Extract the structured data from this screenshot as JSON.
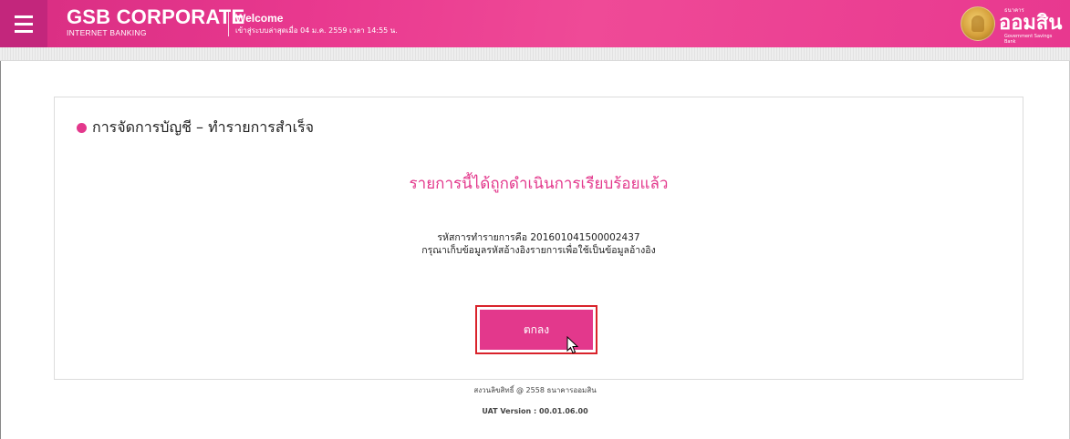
{
  "header": {
    "brand_title": "GSB CORPORATE",
    "brand_subtitle": "INTERNET BANKING",
    "welcome_title": "Welcome",
    "last_login": "เข้าสู่ระบบล่าสุดเมื่อ 04 ม.ค. 2559 เวลา 14:55 น.",
    "logo_small": "ธนาคาร",
    "logo_name": "ออมสิน",
    "logo_en": "Government Savings Bank",
    "menu_icon": "hamburger-menu-icon",
    "color_primary": "#e3388c"
  },
  "main": {
    "section_title": "การจัดการบัญชี – ทำรายการสำเร็จ",
    "success_message": "รายการนี้ได้ถูกดำเนินการเรียบร้อยแล้ว",
    "reference_line": "รหัสการทำรายการคือ 201601041500002437",
    "note_line": "กรุณาเก็บข้อมูลรหัสอ้างอิงรายการเพื่อใช้เป็นข้อมูลอ้างอิง",
    "ok_button": "ตกลง"
  },
  "footer": {
    "copyright": "สงวนลิขสิทธิ์ @ 2558 ธนาคารออมสิน",
    "version": "UAT Version : 00.01.06.00"
  }
}
